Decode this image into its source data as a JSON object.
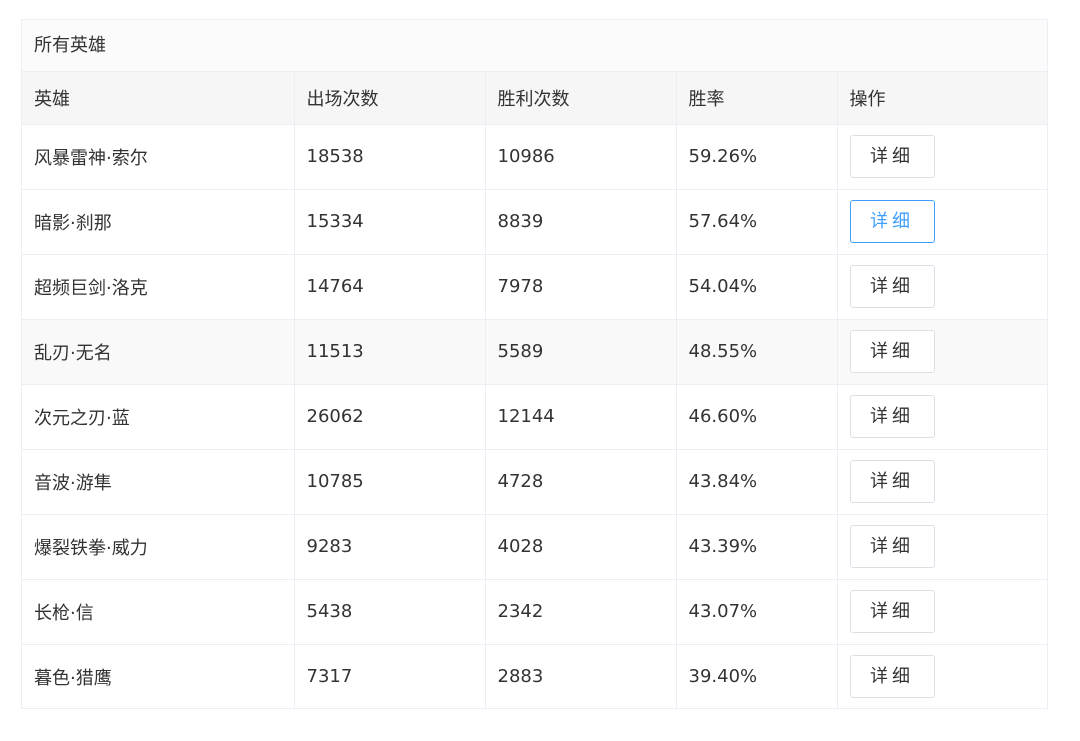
{
  "card": {
    "title": "所有英雄"
  },
  "table": {
    "headers": [
      "英雄",
      "出场次数",
      "胜利次数",
      "胜率",
      "操作"
    ],
    "rows": [
      {
        "hero": "风暴雷神·索尔",
        "appearances": "18538",
        "wins": "10986",
        "win_rate": "59.26%",
        "action": "详细"
      },
      {
        "hero": "暗影·刹那",
        "appearances": "15334",
        "wins": "8839",
        "win_rate": "57.64%",
        "action": "详细"
      },
      {
        "hero": "超频巨剑·洛克",
        "appearances": "14764",
        "wins": "7978",
        "win_rate": "54.04%",
        "action": "详细"
      },
      {
        "hero": "乱刃·无名",
        "appearances": "11513",
        "wins": "5589",
        "win_rate": "48.55%",
        "action": "详细"
      },
      {
        "hero": "次元之刃·蓝",
        "appearances": "26062",
        "wins": "12144",
        "win_rate": "46.60%",
        "action": "详细"
      },
      {
        "hero": "音波·游隼",
        "appearances": "10785",
        "wins": "4728",
        "win_rate": "43.84%",
        "action": "详细"
      },
      {
        "hero": "爆裂铁拳·威力",
        "appearances": "9283",
        "wins": "4028",
        "win_rate": "43.39%",
        "action": "详细"
      },
      {
        "hero": "长枪·信",
        "appearances": "5438",
        "wins": "2342",
        "win_rate": "43.07%",
        "action": "详细"
      },
      {
        "hero": "暮色·猎鹰",
        "appearances": "7317",
        "wins": "2883",
        "win_rate": "39.40%",
        "action": "详细"
      }
    ]
  },
  "colors": {
    "hover_button": "#409eff",
    "border": "#ebeef5",
    "header_bg": "#f6f6f6",
    "alt_row_bg": "#f9f9f9"
  }
}
